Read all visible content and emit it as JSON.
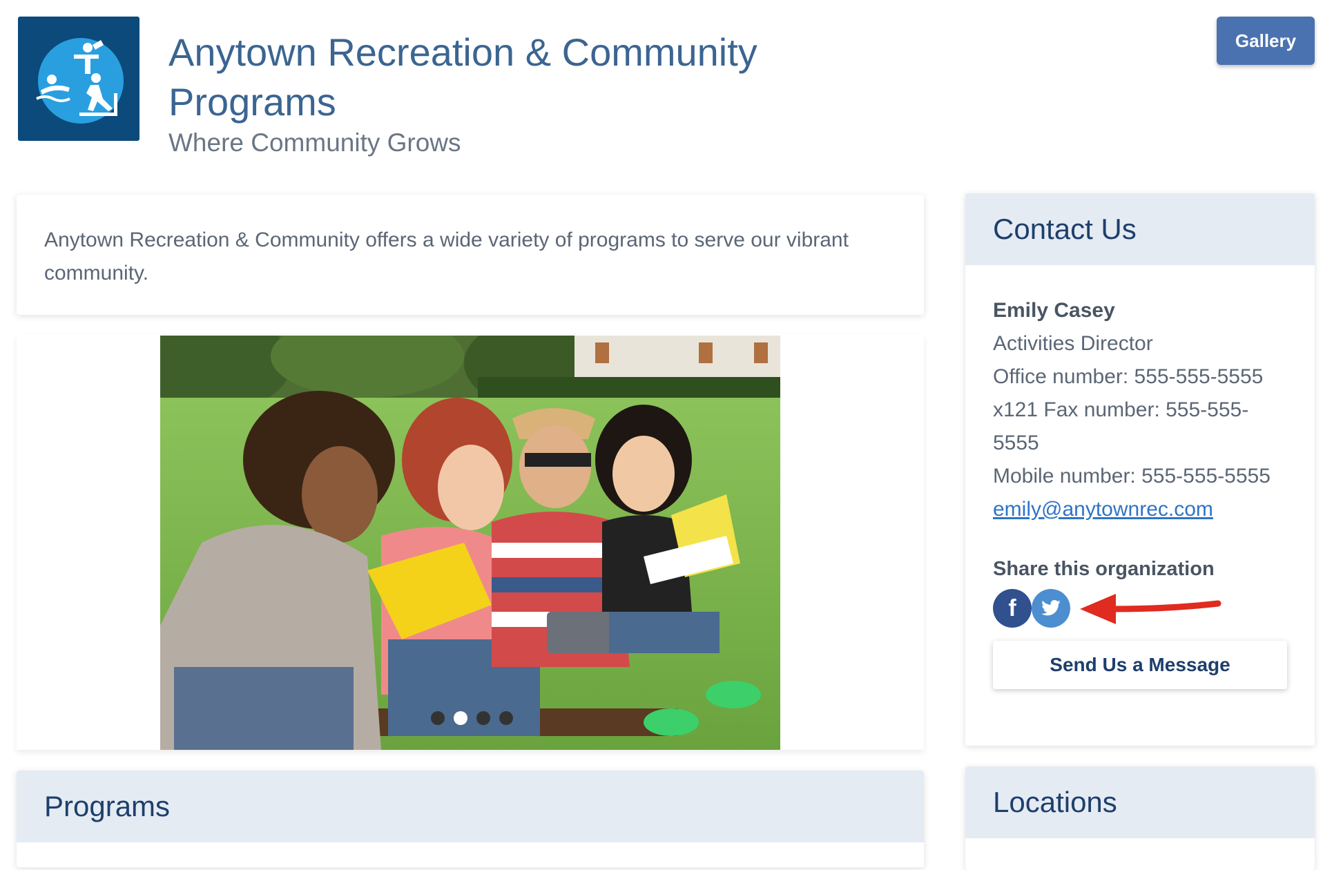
{
  "header": {
    "title": "Anytown Recreation & Community Programs",
    "tagline": "Where Community Grows",
    "gallery_label": "Gallery",
    "logo_icon": "recreation-logo-icon"
  },
  "description": {
    "text": "Anytown Recreation & Community offers a wide variety of programs to serve our vibrant community."
  },
  "carousel": {
    "slide_count": 4,
    "active_index": 1
  },
  "programs": {
    "heading": "Programs"
  },
  "contact": {
    "heading": "Contact Us",
    "name": "Emily Casey",
    "role": "Activities Director",
    "office": "Office number: 555-555-5555 x121 Fax number: 555-555-5555",
    "mobile": "Mobile number: 555-555-5555",
    "email": "emily@anytownrec.com",
    "share_label": "Share this organization",
    "facebook_glyph": "f",
    "message_button": "Send Us a Message"
  },
  "locations": {
    "heading": "Locations"
  },
  "colors": {
    "title_blue": "#3b6591",
    "gallery_button": "#4b72b0",
    "facebook": "#30508e",
    "twitter": "#4c8ed0",
    "annotation_arrow": "#e02b20",
    "card_header": "#e5ebf3"
  }
}
